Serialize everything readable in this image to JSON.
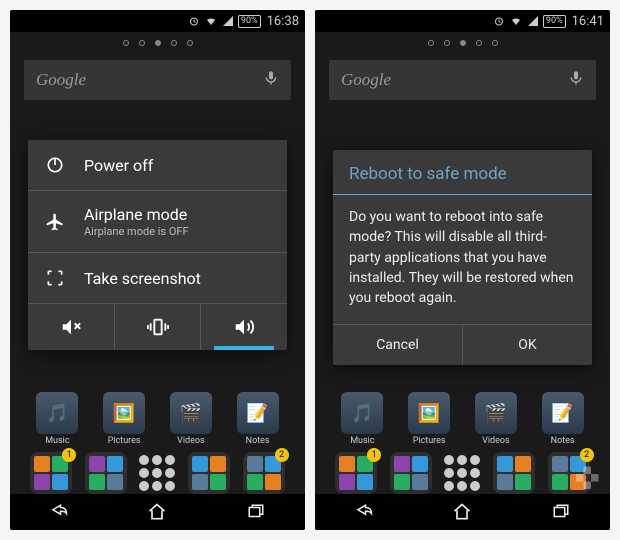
{
  "left": {
    "status": {
      "battery": "90%",
      "clock": "16:38"
    },
    "search": {
      "placeholder": "Google"
    },
    "power_menu": {
      "power_off": "Power off",
      "airplane": "Airplane mode",
      "airplane_sub": "Airplane mode is OFF",
      "screenshot": "Take screenshot"
    },
    "apps": [
      "Music",
      "Pictures",
      "Videos",
      "Notes"
    ],
    "dock_badge_left": "1",
    "dock_badge_right": "2"
  },
  "right": {
    "status": {
      "battery": "90%",
      "clock": "16:41"
    },
    "search": {
      "placeholder": "Google"
    },
    "dialog": {
      "title": "Reboot to safe mode",
      "body": "Do you want to reboot into safe mode? This will disable all third-party applications that you have installed. They will be restored when you reboot again.",
      "cancel": "Cancel",
      "ok": "OK"
    },
    "apps": [
      "Music",
      "Pictures",
      "Videos",
      "Notes"
    ],
    "dock_badge_left": "1",
    "dock_badge_right": "2"
  }
}
